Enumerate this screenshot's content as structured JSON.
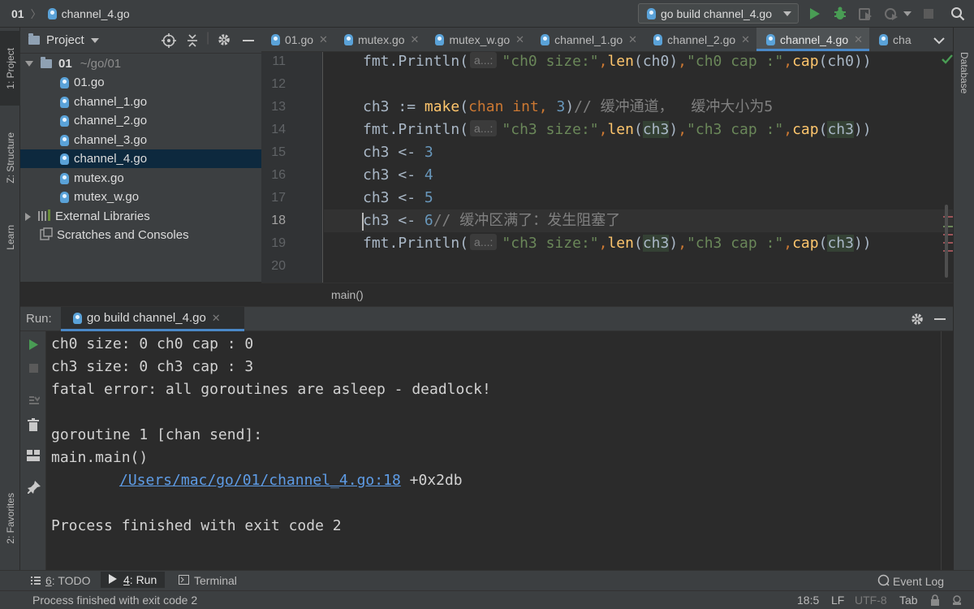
{
  "colors": {
    "accent": "#4a88c7",
    "run_green": "#499c54",
    "selection": "#0d293e",
    "link": "#5e9ce6"
  },
  "navbar": {
    "root": "01",
    "file": "channel_4.go",
    "run_config": "go build channel_4.go"
  },
  "left_strip": {
    "project": "1: Project",
    "structure": "Z: Structure",
    "learn": "Learn",
    "favorites": "2: Favorites"
  },
  "right_strip": {
    "database": "Database"
  },
  "project_panel": {
    "title": "Project",
    "root_name": "01",
    "root_path": "~/go/01",
    "files": [
      "01.go",
      "channel_1.go",
      "channel_2.go",
      "channel_3.go",
      "channel_4.go",
      "mutex.go",
      "mutex_w.go"
    ],
    "selected_file": "channel_4.go",
    "external_libraries": "External Libraries",
    "scratches": "Scratches and Consoles"
  },
  "editor": {
    "tabs": [
      "01.go",
      "mutex.go",
      "mutex_w.go",
      "channel_1.go",
      "channel_2.go",
      "channel_4.go",
      "cha"
    ],
    "active_tab": "channel_4.go",
    "line_numbers": [
      "11",
      "12",
      "13",
      "14",
      "15",
      "16",
      "17",
      "18",
      "19",
      "20"
    ],
    "current_line": "18",
    "hint_label": "a...:",
    "breadcrumb": "main()",
    "lines": {
      "l11": {
        "fn": "fmt.Println(",
        "s1": "\"ch0 size:\"",
        "c1": ",",
        "f1": "len",
        "a1": "(ch0)",
        "c2": ",",
        "s2": "\"ch0 cap :\"",
        "c3": ",",
        "f2": "cap",
        "a2": "(ch0))"
      },
      "l13": {
        "var": "ch3",
        "op": " := ",
        "fn": "make",
        "p1": "(",
        "kw1": "chan",
        "sp": " ",
        "kw2": "int",
        "c": ", ",
        "num": "3",
        "p2": ")",
        "cmt": "// 缓冲通道，  缓冲大小为5"
      },
      "l14": {
        "fn": "fmt.Println(",
        "s1": "\"ch3 size:\"",
        "c1": ",",
        "f1": "len",
        "p1": "(",
        "v1": "ch3",
        "p2": ")",
        "c2": ",",
        "s2": "\"ch3 cap :\"",
        "c3": ",",
        "f2": "cap",
        "p3": "(",
        "v2": "ch3",
        "p4": "))"
      },
      "l15": {
        "var": "ch3",
        "op": " <- ",
        "num": "3"
      },
      "l16": {
        "var": "ch3",
        "op": " <- ",
        "num": "4"
      },
      "l17": {
        "var": "ch3",
        "op": " <- ",
        "num": "5"
      },
      "l18": {
        "var": "ch3",
        "op": " <- ",
        "num": "6",
        "cmt": "// 缓冲区满了：发生阻塞了"
      },
      "l19": {
        "fn": "fmt.Println(",
        "s1": "\"ch3 size:\"",
        "c1": ",",
        "f1": "len",
        "p1": "(",
        "v1": "ch3",
        "p2": ")",
        "c2": ",",
        "s2": "\"ch3 cap :\"",
        "c3": ",",
        "f2": "cap",
        "p3": "(",
        "v2": "ch3",
        "p4": "))"
      }
    }
  },
  "run_panel": {
    "label": "Run:",
    "tab": "go build channel_4.go",
    "output": {
      "l1": "ch0 size: 0 ch0 cap : 0",
      "l2": "ch3 size: 0 ch3 cap : 3",
      "l3": "fatal error: all goroutines are asleep - deadlock!",
      "l4": "goroutine 1 [chan send]:",
      "l5": "main.main()",
      "link": "/Users/mac/go/01/channel_4.go:18",
      "link_suffix": " +0x2db",
      "l7": "Process finished with exit code 2"
    }
  },
  "bottom_tabs": {
    "todo_num": "6",
    "todo_text": ": TODO",
    "run_num": "4",
    "run_text": ": Run",
    "terminal": "Terminal",
    "event_log": "Event Log"
  },
  "status_bar": {
    "message": "Process finished with exit code 2",
    "position": "18:5",
    "line_sep": "LF",
    "encoding": "UTF-8",
    "indent": "Tab"
  }
}
